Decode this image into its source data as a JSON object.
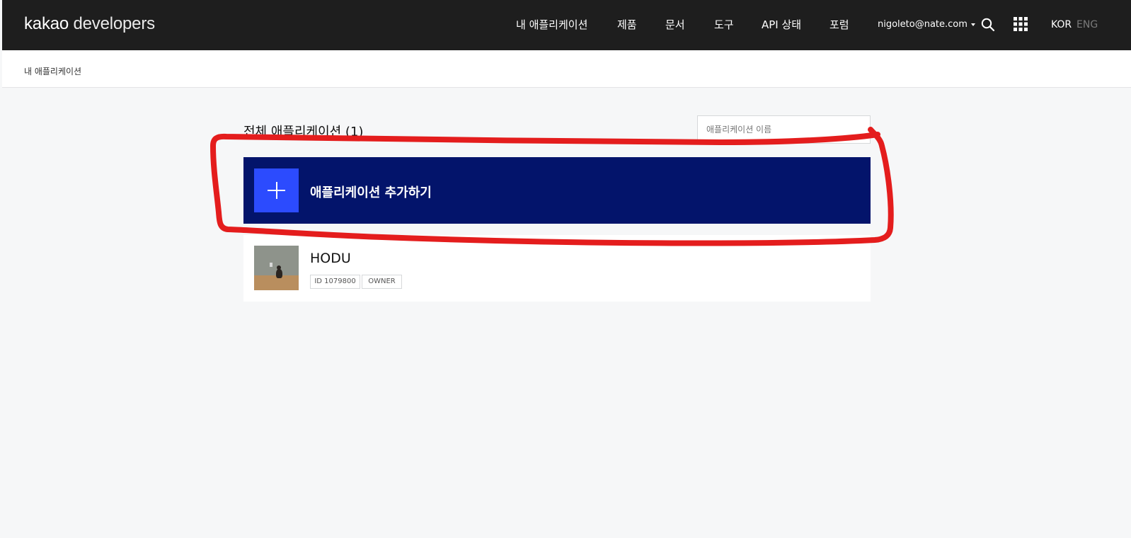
{
  "header": {
    "logo_bold": "kakao",
    "logo_light": "developers",
    "nav": [
      "내 애플리케이션",
      "제품",
      "문서",
      "도구",
      "API 상태",
      "포럼"
    ],
    "user_email": "nigoleto@nate.com",
    "lang_active": "KOR",
    "lang_inactive": "ENG"
  },
  "breadcrumb": "내 애플리케이션",
  "main": {
    "title": "전체 애플리케이션 (1)",
    "search_placeholder": "애플리케이션 이름",
    "add_button_label": "애플리케이션 추가하기",
    "apps": [
      {
        "name": "HODU",
        "id_badge": "ID 1079800",
        "role_badge": "OWNER"
      }
    ]
  },
  "colors": {
    "header_bg": "#1e1e1e",
    "add_bg": "#03146b",
    "plus_bg": "#2c4bfe",
    "annotation": "#e41d1d"
  }
}
